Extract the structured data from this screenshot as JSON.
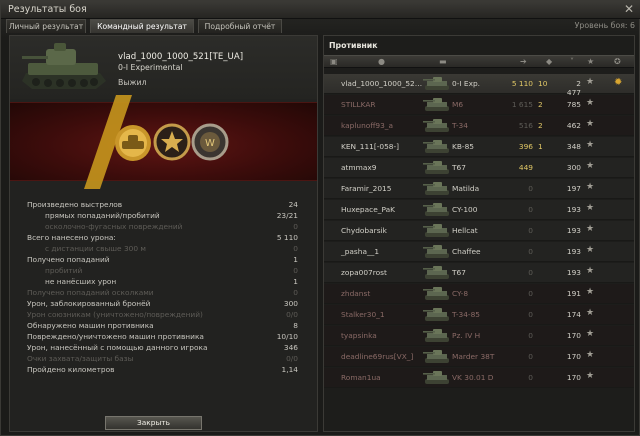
{
  "window": {
    "title": "Результаты боя",
    "level_text": "Уровень боя: 6"
  },
  "tabs": [
    {
      "label": "Личный результат",
      "active": false
    },
    {
      "label": "Командный результат",
      "active": true
    },
    {
      "label": "Подробный отчёт",
      "active": false
    }
  ],
  "player": {
    "name": "vlad_1000_1000_521[TE_UA]",
    "tank": "0-I Experimental",
    "status": "Выжил"
  },
  "awards": [
    "tank-award-icon",
    "medal-icon",
    "badge-icon"
  ],
  "stats": [
    {
      "label": "Произведено выстрелов",
      "value": "24",
      "indent": 0,
      "dim": false
    },
    {
      "label": "прямых попаданий/пробитий",
      "value": "23/21",
      "indent": 1,
      "dim": false
    },
    {
      "label": "осколочно-фугасных повреждений",
      "value": "0",
      "indent": 1,
      "dim": true
    },
    {
      "label": "Всего нанесено урона:",
      "value": "5 110",
      "indent": 0,
      "dim": false
    },
    {
      "label": "с дистанции свыше 300 м",
      "value": "0",
      "indent": 1,
      "dim": true
    },
    {
      "label": "Получено попаданий",
      "value": "1",
      "indent": 0,
      "dim": false
    },
    {
      "label": "пробитий",
      "value": "0",
      "indent": 1,
      "dim": true
    },
    {
      "label": "не нанёсших урон",
      "value": "1",
      "indent": 1,
      "dim": false
    },
    {
      "label": "Получено попаданий осколками",
      "value": "0",
      "indent": 0,
      "dim": true
    },
    {
      "label": "Урон, заблокированный бронёй",
      "value": "300",
      "indent": 0,
      "dim": false
    },
    {
      "label": "Урон союзникам (уничтожено/повреждений)",
      "value": "0/0",
      "indent": 0,
      "dim": true
    },
    {
      "label": "Обнаружено машин противника",
      "value": "8",
      "indent": 0,
      "dim": false
    },
    {
      "label": "Повреждено/уничтожено машин противника",
      "value": "10/10",
      "indent": 0,
      "dim": false
    },
    {
      "label": "Урон, нанесённый с помощью данного игрока",
      "value": "346",
      "indent": 0,
      "dim": false
    },
    {
      "label": "Очки захвата/защиты базы",
      "value": "0/0",
      "indent": 0,
      "dim": true
    },
    {
      "label": "Пройдено километров",
      "value": "1,14",
      "indent": 0,
      "dim": false
    }
  ],
  "close_button": "Закрыть",
  "team": {
    "title": "Противник",
    "rows": [
      {
        "name": "vlad_1000_1000_52…",
        "tank": "0-I Exp.",
        "damage": "5 110",
        "kills": "10",
        "xp": "2 477",
        "self": true,
        "dead": false,
        "dmg_dim": false,
        "kills_dim": false,
        "medal": true
      },
      {
        "name": "STILLKAR",
        "tank": "M6",
        "damage": "1 615",
        "kills": "2",
        "xp": "785",
        "self": false,
        "dead": true,
        "dmg_dim": true,
        "kills_dim": false,
        "medal": false
      },
      {
        "name": "kaplunoff93_a",
        "tank": "T-34",
        "damage": "516",
        "kills": "2",
        "xp": "462",
        "self": false,
        "dead": true,
        "dmg_dim": true,
        "kills_dim": false,
        "medal": false
      },
      {
        "name": "KEN_111[-058-]",
        "tank": "KB-85",
        "damage": "396",
        "kills": "1",
        "xp": "348",
        "self": false,
        "dead": false,
        "dmg_dim": false,
        "kills_dim": false,
        "medal": false
      },
      {
        "name": "atmmax9",
        "tank": "T67",
        "damage": "449",
        "kills": "",
        "xp": "300",
        "self": false,
        "dead": false,
        "dmg_dim": false,
        "kills_dim": false,
        "medal": false
      },
      {
        "name": "Faramir_2015",
        "tank": "Matilda",
        "damage": "0",
        "kills": "",
        "xp": "197",
        "self": false,
        "dead": false,
        "dmg_dim": true,
        "kills_dim": false,
        "medal": false
      },
      {
        "name": "Huxepace_PaK",
        "tank": "CY-100",
        "damage": "0",
        "kills": "",
        "xp": "193",
        "self": false,
        "dead": false,
        "dmg_dim": true,
        "kills_dim": false,
        "medal": false
      },
      {
        "name": "Chydobarsik",
        "tank": "Hellcat",
        "damage": "0",
        "kills": "",
        "xp": "193",
        "self": false,
        "dead": false,
        "dmg_dim": true,
        "kills_dim": false,
        "medal": false
      },
      {
        "name": "_pasha__1",
        "tank": "Chaffee",
        "damage": "0",
        "kills": "",
        "xp": "193",
        "self": false,
        "dead": false,
        "dmg_dim": true,
        "kills_dim": false,
        "medal": false
      },
      {
        "name": "zopa007rost",
        "tank": "T67",
        "damage": "0",
        "kills": "",
        "xp": "193",
        "self": false,
        "dead": false,
        "dmg_dim": true,
        "kills_dim": false,
        "medal": false
      },
      {
        "name": "zhdanst",
        "tank": "CY-8",
        "damage": "0",
        "kills": "",
        "xp": "191",
        "self": false,
        "dead": true,
        "dmg_dim": true,
        "kills_dim": false,
        "medal": false
      },
      {
        "name": "Stalker30_1",
        "tank": "T-34-85",
        "damage": "0",
        "kills": "",
        "xp": "174",
        "self": false,
        "dead": true,
        "dmg_dim": true,
        "kills_dim": false,
        "medal": false
      },
      {
        "name": "tyapsinka",
        "tank": "Pz. IV H",
        "damage": "0",
        "kills": "",
        "xp": "170",
        "self": false,
        "dead": true,
        "dmg_dim": true,
        "kills_dim": false,
        "medal": false
      },
      {
        "name": "deadline69rus[VX_]",
        "tank": "Marder 38T",
        "damage": "0",
        "kills": "",
        "xp": "170",
        "self": false,
        "dead": true,
        "dmg_dim": true,
        "kills_dim": false,
        "medal": false
      },
      {
        "name": "Roman1ua",
        "tank": "VK 30.01 D",
        "damage": "0",
        "kills": "",
        "xp": "170",
        "self": false,
        "dead": true,
        "dmg_dim": true,
        "kills_dim": false,
        "medal": false
      }
    ]
  }
}
